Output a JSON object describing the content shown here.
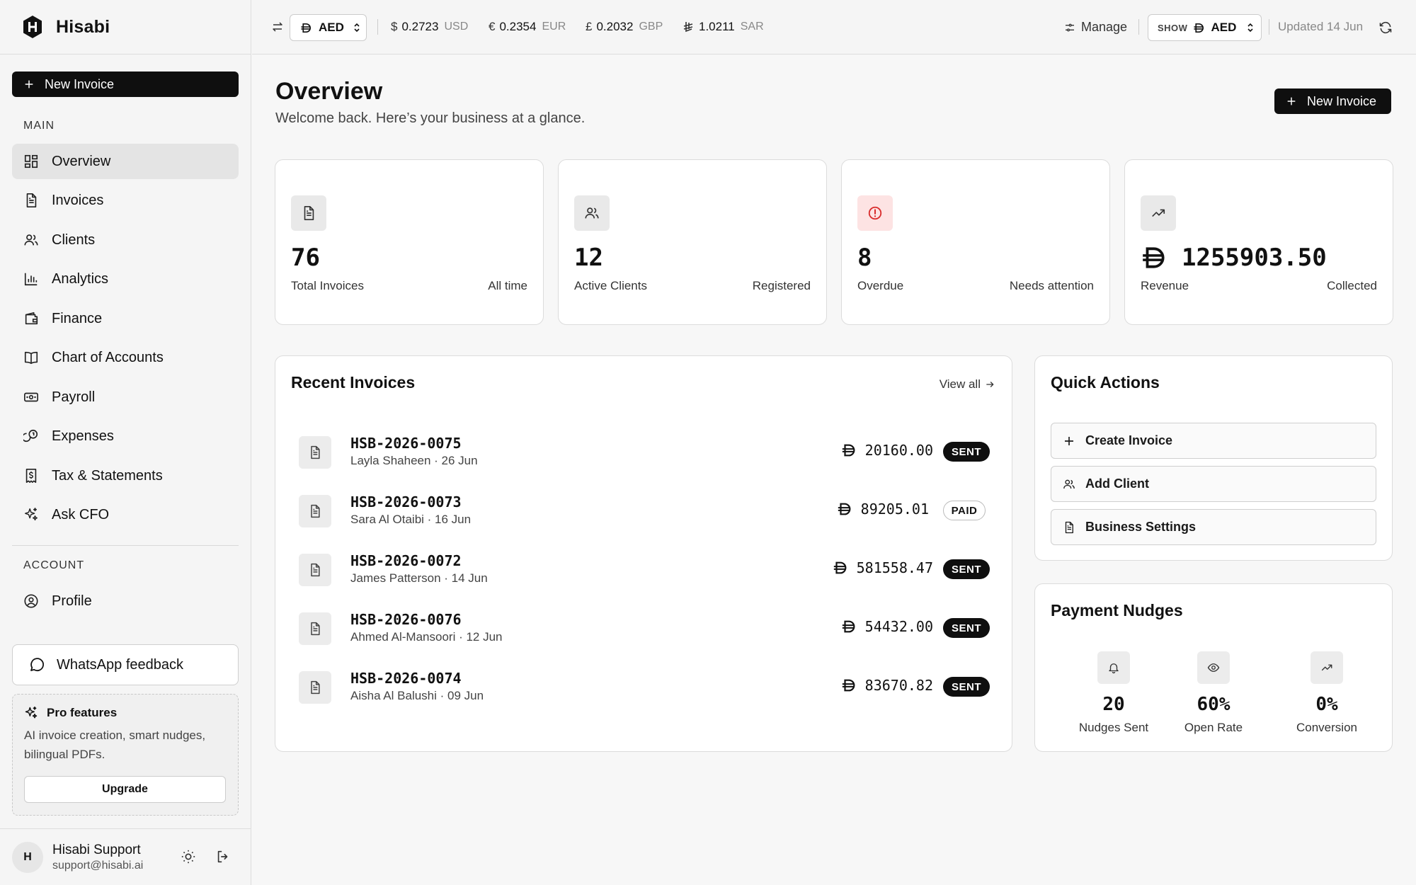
{
  "brand": {
    "name": "Hisabi",
    "logo_letter": "H"
  },
  "sidebar": {
    "new_invoice_label": "New Invoice",
    "main_label": "MAIN",
    "items": [
      {
        "label": "Overview",
        "icon": "grid-icon",
        "active": true
      },
      {
        "label": "Invoices",
        "icon": "file-icon"
      },
      {
        "label": "Clients",
        "icon": "users-icon"
      },
      {
        "label": "Analytics",
        "icon": "bar-chart-icon"
      },
      {
        "label": "Finance",
        "icon": "wallet-icon"
      },
      {
        "label": "Chart of Accounts",
        "icon": "book-icon"
      },
      {
        "label": "Payroll",
        "icon": "banknote-icon"
      },
      {
        "label": "Expenses",
        "icon": "coins-icon"
      },
      {
        "label": "Tax & Statements",
        "icon": "receipt-icon"
      },
      {
        "label": "Ask CFO",
        "icon": "sparkles-icon"
      }
    ],
    "account_label": "ACCOUNT",
    "account_items": [
      {
        "label": "Profile",
        "icon": "user-circle-icon"
      }
    ],
    "whatsapp_label": "WhatsApp feedback",
    "pro": {
      "title": "Pro features",
      "desc": "AI invoice creation, smart nudges, bilingual PDFs.",
      "button": "Upgrade"
    },
    "user": {
      "initial": "H",
      "name": "Hisabi Support",
      "email": "support@hisabi.ai"
    }
  },
  "topbar": {
    "base_currency": "AED",
    "rates": [
      {
        "symbol": "$",
        "value": "0.2723",
        "code": "USD"
      },
      {
        "symbol": "€",
        "value": "0.2354",
        "code": "EUR"
      },
      {
        "symbol": "£",
        "value": "0.2032",
        "code": "GBP"
      },
      {
        "symbol": "⃁",
        "value": "1.0211",
        "code": "SAR"
      }
    ],
    "manage_label": "Manage",
    "show_label": "SHOW",
    "show_currency": "AED",
    "updated": "Updated 14 Jun"
  },
  "main": {
    "title": "Overview",
    "subtitle": "Welcome back. Here’s your business at a glance.",
    "new_invoice_label": "New Invoice",
    "stats": [
      {
        "value": "76",
        "label": "Total Invoices",
        "note": "All time",
        "icon": "file-icon"
      },
      {
        "value": "12",
        "label": "Active Clients",
        "note": "Registered",
        "icon": "users-icon"
      },
      {
        "value": "8",
        "label": "Overdue",
        "note": "Needs attention",
        "icon": "alert-circle-icon"
      },
      {
        "value": "1255903.50",
        "label": "Revenue",
        "note": "Collected",
        "icon": "trending-up-icon"
      }
    ],
    "recent": {
      "title": "Recent Invoices",
      "view_all": "View all",
      "rows": [
        {
          "id": "HSB-2026-0075",
          "meta": "Layla Shaheen · 26 Jun",
          "amount": "20160.00",
          "status": "SENT"
        },
        {
          "id": "HSB-2026-0073",
          "meta": "Sara Al Otaibi · 16 Jun",
          "amount": "89205.01",
          "status": "PAID"
        },
        {
          "id": "HSB-2026-0072",
          "meta": "James Patterson · 14 Jun",
          "amount": "581558.47",
          "status": "SENT"
        },
        {
          "id": "HSB-2026-0076",
          "meta": "Ahmed Al-Mansoori · 12 Jun",
          "amount": "54432.00",
          "status": "SENT"
        },
        {
          "id": "HSB-2026-0074",
          "meta": "Aisha Al Balushi · 09 Jun",
          "amount": "83670.82",
          "status": "SENT"
        }
      ]
    },
    "quick": {
      "title": "Quick Actions",
      "actions": [
        {
          "label": "Create Invoice",
          "icon": "plus-icon"
        },
        {
          "label": "Add Client",
          "icon": "users-icon"
        },
        {
          "label": "Business Settings",
          "icon": "file-icon"
        }
      ]
    },
    "nudges": {
      "title": "Payment Nudges",
      "items": [
        {
          "value": "20",
          "label": "Nudges Sent",
          "icon": "bell-icon"
        },
        {
          "value": "60%",
          "label": "Open Rate",
          "icon": "eye-icon"
        },
        {
          "value": "0%",
          "label": "Conversion",
          "icon": "trending-up-icon"
        }
      ]
    }
  }
}
